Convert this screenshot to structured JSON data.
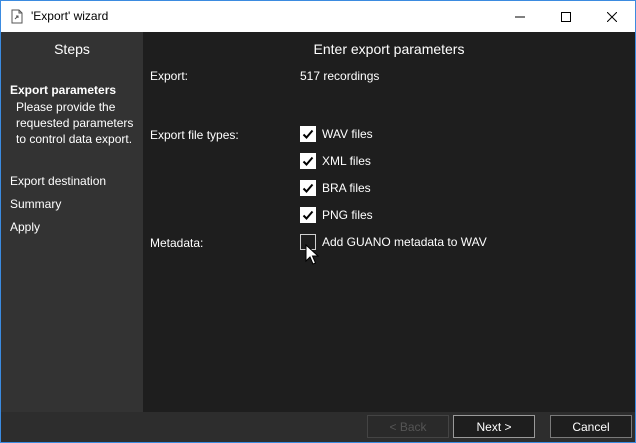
{
  "window": {
    "title": "'Export' wizard",
    "icons": {
      "app": "export-document-icon",
      "minimize": "minimize-icon",
      "maximize": "maximize-icon",
      "close": "close-icon"
    }
  },
  "sidebar": {
    "heading": "Steps",
    "steps": [
      {
        "label": "Export parameters",
        "active": true
      },
      {
        "label": "Export destination",
        "active": false
      },
      {
        "label": "Summary",
        "active": false
      },
      {
        "label": "Apply",
        "active": false
      }
    ],
    "active_description": "Please provide the requested parameters to control data export."
  },
  "main": {
    "heading": "Enter export parameters",
    "export_label": "Export:",
    "export_value": "517 recordings",
    "file_types_label": "Export file types:",
    "file_types": [
      {
        "label": "WAV files",
        "checked": true
      },
      {
        "label": "XML files",
        "checked": true
      },
      {
        "label": "BRA files",
        "checked": true
      },
      {
        "label": "PNG files",
        "checked": true
      }
    ],
    "metadata_label": "Metadata:",
    "metadata_option": {
      "label": "Add GUANO metadata to WAV",
      "checked": false
    }
  },
  "footer": {
    "back_label": "< Back",
    "next_label": "Next >",
    "cancel_label": "Cancel"
  },
  "colors": {
    "sidebar_bg": "#333333",
    "content_bg": "#1e1e1e",
    "window_border": "#3b8be0"
  }
}
